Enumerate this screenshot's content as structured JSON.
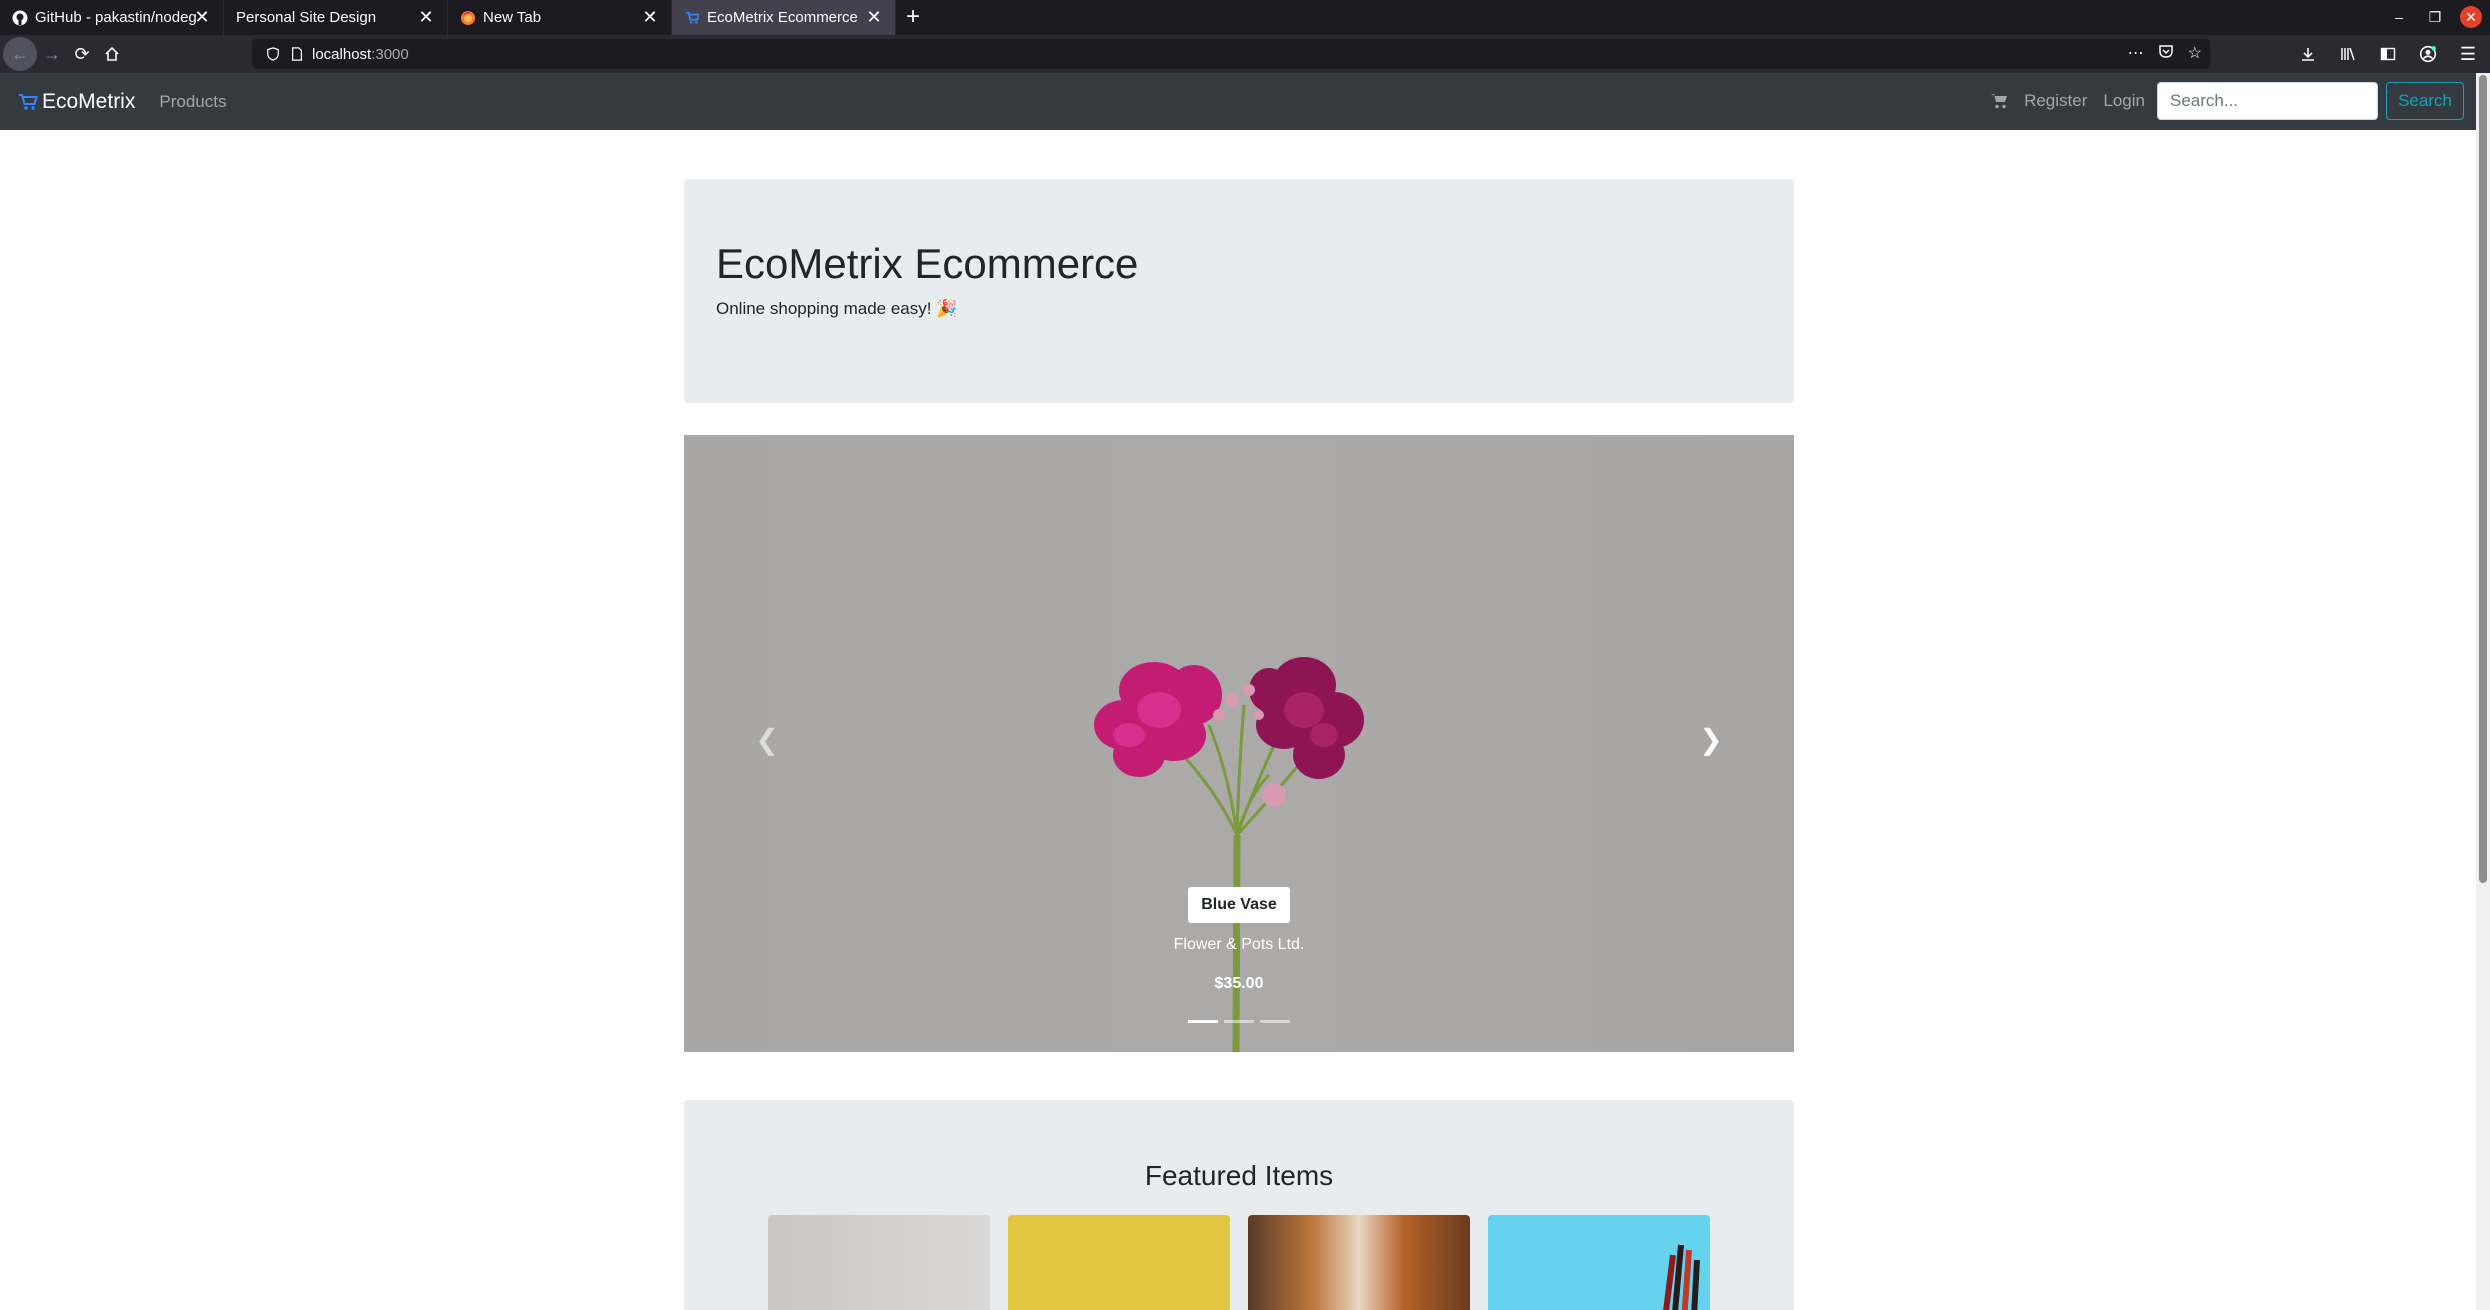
{
  "browser": {
    "tabs": [
      {
        "title": "GitHub - pakastin/nodeg",
        "icon": "github-icon",
        "active": false
      },
      {
        "title": "Personal Site Design",
        "icon": "",
        "active": false
      },
      {
        "title": "New Tab",
        "icon": "firefox-icon",
        "active": false
      },
      {
        "title": "EcoMetrix Ecommerce",
        "icon": "cart-icon",
        "active": true
      }
    ],
    "url_host": "localhost",
    "url_port": ":3000"
  },
  "site": {
    "brand": "EcoMetrix",
    "nav": {
      "products": "Products",
      "register": "Register",
      "login": "Login"
    },
    "search": {
      "placeholder": "Search...",
      "button": "Search"
    }
  },
  "hero": {
    "title": "EcoMetrix Ecommerce",
    "subtitle": "Online shopping made easy! 🎉"
  },
  "carousel": {
    "slide": {
      "title": "Blue Vase",
      "company": "Flower & Pots Ltd.",
      "price": "$35.00"
    },
    "slides_count": 3,
    "active_index": 0
  },
  "featured": {
    "title": "Featured Items"
  },
  "colors": {
    "navbar": "#343a40",
    "jumbotron": "#e9ecef",
    "search_accent": "#17a2b8"
  }
}
